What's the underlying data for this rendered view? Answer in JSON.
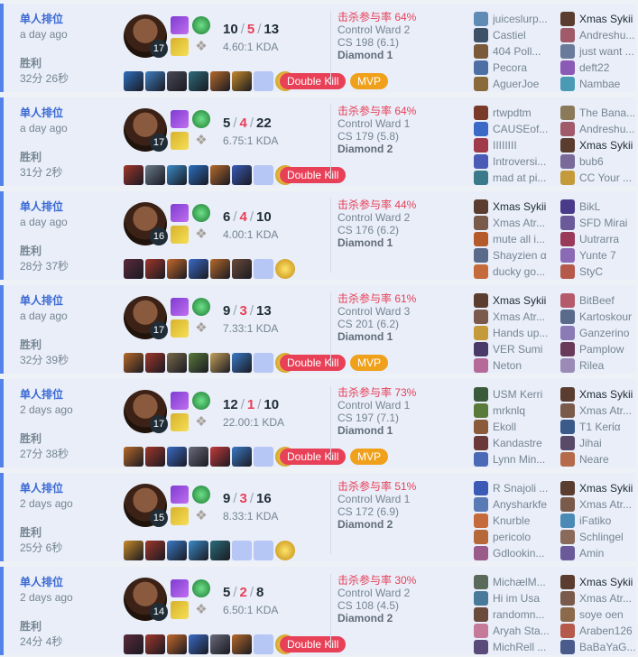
{
  "matches": [
    {
      "mode": "单人排位",
      "ago": "a day ago",
      "result": "胜利",
      "duration": "32分 26秒",
      "level": "17",
      "kills": "10",
      "deaths": "5",
      "assists": "13",
      "ratio": "4.60:1 KDA",
      "kill_participation": "击杀参与率 64%",
      "control_ward": "Control Ward 2",
      "cs": "CS 198 (6.1)",
      "rank": "Diamond 1",
      "badges": [
        "Double Kill",
        "MVP"
      ],
      "items": [
        "#2d6fbd",
        "#3e7fc1",
        "#4a4a58",
        "#2b6c7a",
        "#b5692a",
        "#c48a2a",
        "empty"
      ],
      "team1": [
        {
          "name": "juicеslurp...",
          "color": "#5f8bb5"
        },
        {
          "name": "Castiel",
          "color": "#3d5266"
        },
        {
          "name": "404 Poll...",
          "color": "#7a5a3a"
        },
        {
          "name": "Pecora",
          "color": "#4d6fa5"
        },
        {
          "name": "AguerJoe",
          "color": "#8a6a3a"
        }
      ],
      "team2": [
        {
          "name": "Xmas Sykii",
          "color": "#5a3d2f",
          "me": true
        },
        {
          "name": "Andreshu...",
          "color": "#a05a6a"
        },
        {
          "name": "just want ...",
          "color": "#6a7a9a"
        },
        {
          "name": "deft22",
          "color": "#8a5ab5"
        },
        {
          "name": "Nambae",
          "color": "#4a9ab5"
        }
      ]
    },
    {
      "mode": "单人排位",
      "ago": "a day ago",
      "result": "胜利",
      "duration": "31分 2秒",
      "level": "17",
      "kills": "5",
      "deaths": "4",
      "assists": "22",
      "ratio": "6.75:1 KDA",
      "kill_participation": "击杀参与率 64%",
      "control_ward": "Control Ward 1",
      "cs": "CS 179 (5.8)",
      "rank": "Diamond 2",
      "badges": [
        "Double Kill"
      ],
      "items": [
        "#a0362a",
        "#6a7a8a",
        "#3a8ac8",
        "#2a6fc1",
        "#b5692a",
        "#3a5ab5",
        "empty"
      ],
      "team1": [
        {
          "name": "rtwpdtm",
          "color": "#7a3a2a"
        },
        {
          "name": "CAUSEof...",
          "color": "#3a6ac5"
        },
        {
          "name": "IIIIIIII",
          "color": "#a03a4a"
        },
        {
          "name": "Introversi...",
          "color": "#4a5ab5"
        },
        {
          "name": "mad at pi...",
          "color": "#3a7a8a"
        }
      ],
      "team2": [
        {
          "name": "The Bana...",
          "color": "#8a7a5a"
        },
        {
          "name": "Andreshu...",
          "color": "#a05a6a"
        },
        {
          "name": "Xmas Sykii",
          "color": "#5a3d2f",
          "me": true
        },
        {
          "name": "bub6",
          "color": "#7a6a9a"
        },
        {
          "name": "CC Your ...",
          "color": "#c59a3a"
        }
      ]
    },
    {
      "mode": "单人排位",
      "ago": "a day ago",
      "result": "胜利",
      "duration": "28分 37秒",
      "level": "16",
      "kills": "6",
      "deaths": "4",
      "assists": "10",
      "ratio": "4.00:1 KDA",
      "kill_participation": "击杀参与率 44%",
      "control_ward": "Control Ward 2",
      "cs": "CS 176 (6.2)",
      "rank": "Diamond 1",
      "badges": [],
      "items": [
        "#5a2a3a",
        "#a0362a",
        "#c5692a",
        "#3a6ac5",
        "#b5692a",
        "#6a4a3a",
        "empty"
      ],
      "team1": [
        {
          "name": "Xmas Sykii",
          "color": "#5a3d2f",
          "me": true
        },
        {
          "name": "Xmas Atr...",
          "color": "#7a5a4a"
        },
        {
          "name": "mute all i...",
          "color": "#b55a2a"
        },
        {
          "name": "Shayzien α",
          "color": "#5a6a8a"
        },
        {
          "name": "ducky go...",
          "color": "#c56a3a"
        }
      ],
      "team2": [
        {
          "name": "BikL",
          "color": "#4a3a8a"
        },
        {
          "name": "SFD Mirai",
          "color": "#6a5a9a"
        },
        {
          "name": "Uutrarra",
          "color": "#9a3a5a"
        },
        {
          "name": "Yunte 7",
          "color": "#8a6ab5"
        },
        {
          "name": "StyC",
          "color": "#b55a4a"
        }
      ]
    },
    {
      "mode": "单人排位",
      "ago": "a day ago",
      "result": "胜利",
      "duration": "32分 39秒",
      "level": "17",
      "kills": "9",
      "deaths": "3",
      "assists": "13",
      "ratio": "7.33:1 KDA",
      "kill_participation": "击杀参与率 61%",
      "control_ward": "Control Ward 3",
      "cs": "CS 201 (6.2)",
      "rank": "Diamond 1",
      "badges": [
        "Double Kill",
        "MVP"
      ],
      "items": [
        "#b5692a",
        "#a0362a",
        "#7a6a4a",
        "#5a7a3a",
        "#c5a05a",
        "#3a7ac5",
        "empty"
      ],
      "team1": [
        {
          "name": "Xmas Sykii",
          "color": "#5a3d2f",
          "me": true
        },
        {
          "name": "Xmas Atr...",
          "color": "#7a5a4a"
        },
        {
          "name": "Hands up...",
          "color": "#c59a3a"
        },
        {
          "name": "VER Sumi",
          "color": "#4a3a6a"
        },
        {
          "name": "Neton",
          "color": "#b56a9a"
        }
      ],
      "team2": [
        {
          "name": "BitBeef",
          "color": "#b55a6a"
        },
        {
          "name": "Kartoskour",
          "color": "#5a6a8a"
        },
        {
          "name": "Ganzerino",
          "color": "#8a7ab5"
        },
        {
          "name": "Pamplow",
          "color": "#6a3a5a"
        },
        {
          "name": "Rilea",
          "color": "#9a8ab5"
        }
      ]
    },
    {
      "mode": "单人排位",
      "ago": "2 days ago",
      "result": "胜利",
      "duration": "27分 38秒",
      "level": "17",
      "kills": "12",
      "deaths": "1",
      "assists": "10",
      "ratio": "22.00:1 KDA",
      "kill_participation": "击杀参与率 73%",
      "control_ward": "Control Ward 1",
      "cs": "CS 197 (7.1)",
      "rank": "Diamond 1",
      "badges": [
        "Double Kill",
        "MVP"
      ],
      "items": [
        "#b5692a",
        "#a0362a",
        "#3a6ac5",
        "#6a6a7a",
        "#c53a3a",
        "#3a7ac5",
        "empty"
      ],
      "team1": [
        {
          "name": "USM Kerri",
          "color": "#3a5a3a"
        },
        {
          "name": "mrknlq",
          "color": "#5a7a3a"
        },
        {
          "name": "Ekoll",
          "color": "#8a5a3a"
        },
        {
          "name": "Kandastre",
          "color": "#6a3a3a"
        },
        {
          "name": "Lynn Min...",
          "color": "#4a6ab5"
        }
      ],
      "team2": [
        {
          "name": "Xmas Sykii",
          "color": "#5a3d2f",
          "me": true
        },
        {
          "name": "Xmas Atr...",
          "color": "#7a5a4a"
        },
        {
          "name": "T1 Kerία",
          "color": "#3a5a8a"
        },
        {
          "name": "Jihai",
          "color": "#5a4a6a"
        },
        {
          "name": "Neare",
          "color": "#b56a4a"
        }
      ]
    },
    {
      "mode": "单人排位",
      "ago": "2 days ago",
      "result": "胜利",
      "duration": "25分 6秒",
      "level": "15",
      "kills": "9",
      "deaths": "3",
      "assists": "16",
      "ratio": "8.33:1 KDA",
      "kill_participation": "击杀参与率 51%",
      "control_ward": "Control Ward 1",
      "cs": "CS 172 (6.9)",
      "rank": "Diamond 2",
      "badges": [],
      "items": [
        "#c58a2a",
        "#a0362a",
        "#3a7ac5",
        "#3a8ac8",
        "#2b6c7a",
        "empty",
        "empty2"
      ],
      "team1": [
        {
          "name": "R Snajoli ...",
          "color": "#3a5ab5"
        },
        {
          "name": "Anysharkfe",
          "color": "#5a7ab5"
        },
        {
          "name": "Knurble",
          "color": "#c56a3a"
        },
        {
          "name": "pericolo",
          "color": "#b5693a"
        },
        {
          "name": "Gdlookin...",
          "color": "#9a5a8a"
        }
      ],
      "team2": [
        {
          "name": "Xmas Sykii",
          "color": "#5a3d2f",
          "me": true
        },
        {
          "name": "Xmas Atr...",
          "color": "#7a5a4a"
        },
        {
          "name": "iFatiko",
          "color": "#4a8ab5"
        },
        {
          "name": "Schlingel",
          "color": "#8a6a5a"
        },
        {
          "name": "Amin",
          "color": "#6a5a9a"
        }
      ]
    },
    {
      "mode": "单人排位",
      "ago": "2 days ago",
      "result": "胜利",
      "duration": "24分 4秒",
      "level": "14",
      "kills": "5",
      "deaths": "2",
      "assists": "8",
      "ratio": "6.50:1 KDA",
      "kill_participation": "击杀参与率 30%",
      "control_ward": "Control Ward 2",
      "cs": "CS 108 (4.5)",
      "rank": "Diamond 2",
      "badges": [
        "Double Kill"
      ],
      "items": [
        "#5a2a3a",
        "#a0362a",
        "#c5692a",
        "#3a6ac5",
        "#6a6a7a",
        "#b5692a",
        "empty"
      ],
      "team1": [
        {
          "name": "MichælM...",
          "color": "#5a6a5a"
        },
        {
          "name": "Hi im Usa",
          "color": "#4a7a9a"
        },
        {
          "name": "randomn...",
          "color": "#6a4a3a"
        },
        {
          "name": "Aryah Sta...",
          "color": "#c57a9a"
        },
        {
          "name": "MichRell ...",
          "color": "#5a4a7a"
        }
      ],
      "team2": [
        {
          "name": "Xmas Sykii",
          "color": "#5a3d2f",
          "me": true
        },
        {
          "name": "Xmas Atr...",
          "color": "#7a5a4a"
        },
        {
          "name": "soye oen",
          "color": "#8a6a4a"
        },
        {
          "name": "Araben126",
          "color": "#b55a4a"
        },
        {
          "name": "BaBaYaG...",
          "color": "#4a5a8a"
        }
      ]
    }
  ]
}
